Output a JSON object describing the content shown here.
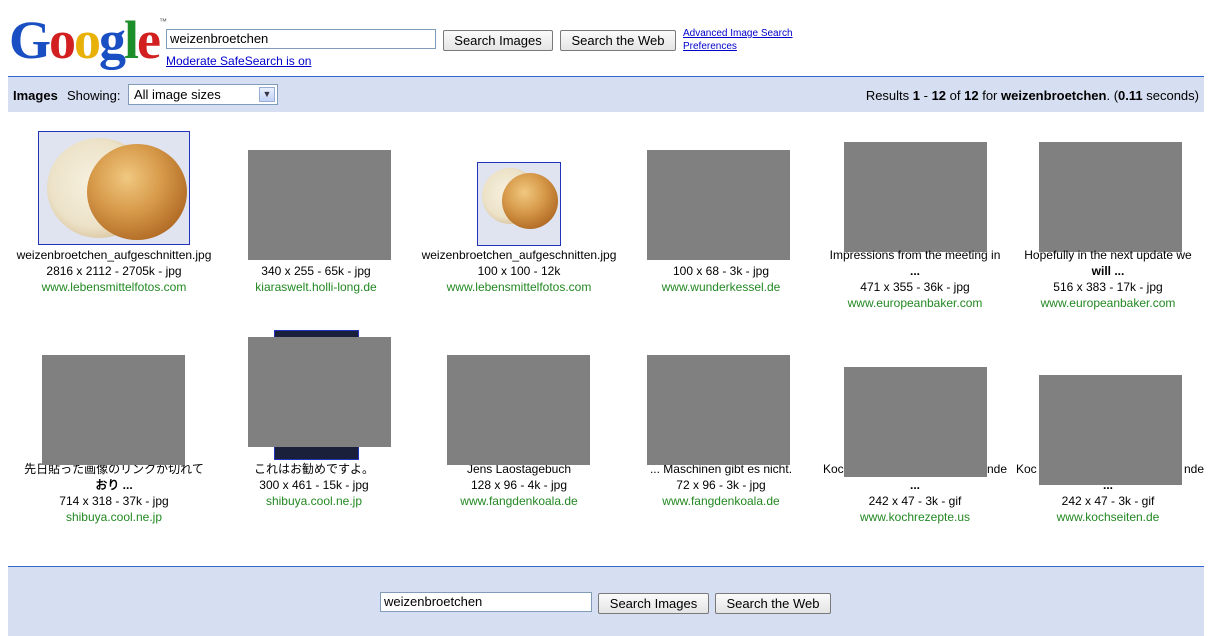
{
  "logo": {
    "text": "Google",
    "tm": "™"
  },
  "search": {
    "query": "weizenbroetchen",
    "search_images_label": "Search Images",
    "search_web_label": "Search the Web",
    "advanced_label": "Advanced Image Search",
    "preferences_label": "Preferences",
    "safesearch_label": "Moderate SafeSearch is on"
  },
  "bar": {
    "images_label": "Images",
    "showing_label": "Showing:",
    "size_option": "All image sizes",
    "results_prefix": "Results ",
    "range_start": "1",
    "range_sep": " - ",
    "range_end": "12",
    "of_label": " of ",
    "total": "12",
    "for_label": " for ",
    "query": "weizenbroetchen",
    "time_prefix": ". (",
    "time": "0.11",
    "time_suffix": " seconds)"
  },
  "results": [
    {
      "name": "weizenbroetchen_aufgeschnitten.jpg",
      "dims": "2816 x 2112 - 2705k - jpg",
      "site": "www.lebensmittelfotos.com"
    },
    {
      "name": "",
      "dims": "340 x 255 - 65k - jpg",
      "site": "kiaraswelt.holli-long.de"
    },
    {
      "name": "weizenbroetchen_aufgeschnitten.jpg",
      "dims": "100 x 100 - 12k",
      "site": "www.lebensmittelfotos.com"
    },
    {
      "name": "",
      "dims": "100 x 68 - 3k - jpg",
      "site": "www.wunderkessel.de"
    },
    {
      "name": "Impressions from the meeting in",
      "name2": "...",
      "dims": "471 x 355 - 36k - jpg",
      "site": "www.europeanbaker.com"
    },
    {
      "name": "Hopefully in the next update we",
      "name2": "will ...",
      "dims": "516 x 383 - 17k - jpg",
      "site": "www.europeanbaker.com"
    },
    {
      "name": "先日貼った画像のリンクが切れて",
      "name2": "おり ...",
      "dims": "714 x 318 - 37k - jpg",
      "site": "shibuya.cool.ne.jp"
    },
    {
      "name": "これはお勧めですよ。",
      "dims": "300 x 461 - 15k - jpg",
      "site": "shibuya.cool.ne.jp"
    },
    {
      "name": "Jens Laostagebuch",
      "dims": "128 x 96 - 4k - jpg",
      "site": "www.fangdenkoala.de"
    },
    {
      "name": "... Maschinen gibt es nicht.",
      "dims": "72 x 96 - 3k - jpg",
      "site": "www.fangdenkoala.de"
    },
    {
      "name": "Koc",
      "name_end": "nde",
      "name2": "...",
      "dims": "242 x 47 - 3k - gif",
      "site": "www.kochrezepte.us"
    },
    {
      "name": "Koc",
      "name_end": "nde",
      "name2": "...",
      "dims": "242 x 47 - 3k - gif",
      "site": "www.kochseiten.de"
    }
  ],
  "footer": {
    "query": "weizenbroetchen",
    "search_images_label": "Search Images",
    "search_web_label": "Search the Web"
  },
  "colors": {
    "link": "#0000cc",
    "site": "#228822",
    "bar": "#d6def2",
    "placeholder": "#808080"
  }
}
